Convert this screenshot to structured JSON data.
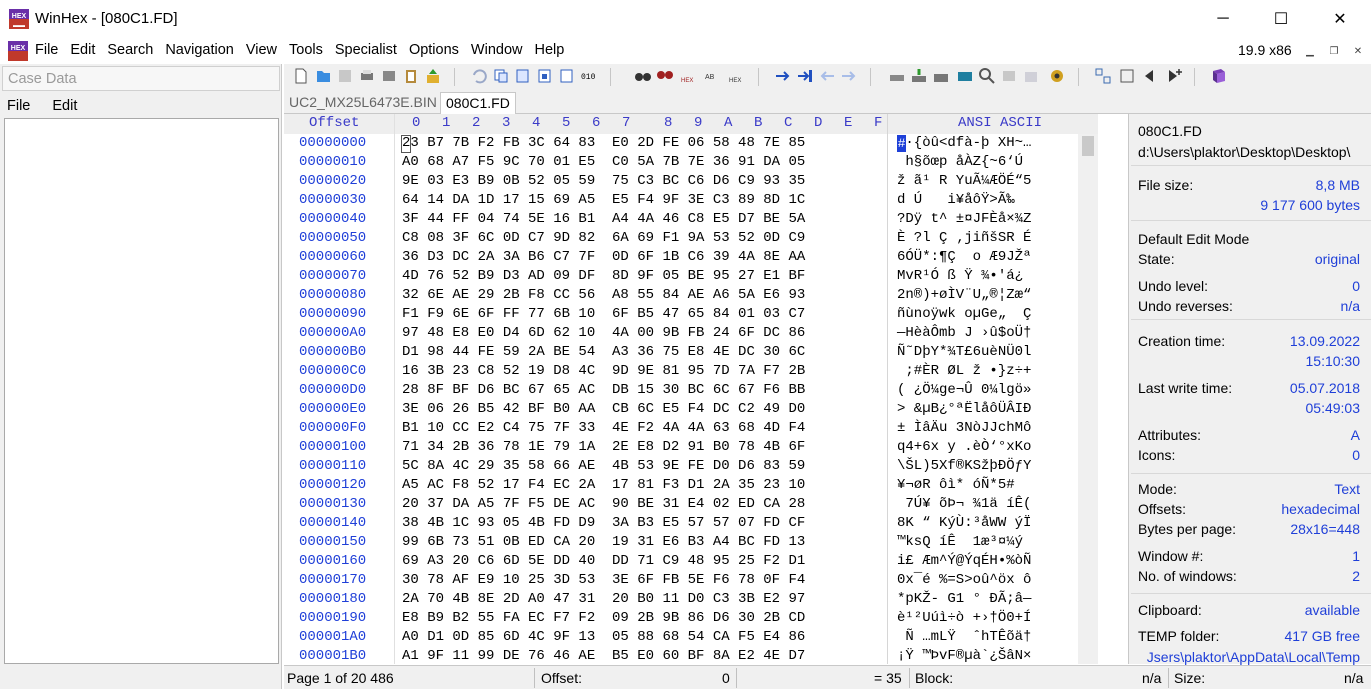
{
  "window": {
    "title": "WinHex - [080C1.FD]",
    "version": "19.9 x86",
    "controls": {
      "minimize": "─",
      "maximize": "☐",
      "close": "✕"
    }
  },
  "menu": [
    "File",
    "Edit",
    "Search",
    "Navigation",
    "View",
    "Tools",
    "Specialist",
    "Options",
    "Window",
    "Help"
  ],
  "case_pane": {
    "header": "Case Data",
    "menu": [
      "File",
      "Edit"
    ]
  },
  "tabs": [
    {
      "label": "UC2_MX25L6473E.BIN",
      "active": false
    },
    {
      "label": "080C1.FD",
      "active": true
    }
  ],
  "hex": {
    "offset_header": "Offset",
    "columns": [
      "0",
      "1",
      "2",
      "3",
      "4",
      "5",
      "6",
      "7",
      "8",
      "9",
      "A",
      "B",
      "C",
      "D",
      "E",
      "F"
    ],
    "ascii_header": "ANSI ASCII",
    "rows": [
      {
        "offset": "00000000",
        "bytes": "23 B7 7B F2 FB 3C 64 83  E0 2D FE 06 58 48 7E 85",
        "ascii": "#·{òû<dfà-þ XH~…"
      },
      {
        "offset": "00000010",
        "bytes": "A0 68 A7 F5 9C 70 01 E5  C0 5A 7B 7E 36 91 DA 05",
        "ascii": " h§õœp åÀZ{~6‘Ú "
      },
      {
        "offset": "00000020",
        "bytes": "9E 03 E3 B9 0B 52 05 59  75 C3 BC C6 D6 C9 93 35",
        "ascii": "ž ã¹ R YuÃ¼ÆÖÉ“5"
      },
      {
        "offset": "00000030",
        "bytes": "64 14 DA 1D 17 15 69 A5  E5 F4 9F 3E C3 89 8D 1C",
        "ascii": "d Ú   i¥åôŸ>Ã‰  "
      },
      {
        "offset": "00000040",
        "bytes": "3F 44 FF 04 74 5E 16 B1  A4 4A 46 C8 E5 D7 BE 5A",
        "ascii": "?Dÿ t^ ±¤JFÈå×¾Z"
      },
      {
        "offset": "00000050",
        "bytes": "C8 08 3F 6C 0D C7 9D 82  6A 69 F1 9A 53 52 0D C9",
        "ascii": "È ?l Ç ‚jiñšSR É"
      },
      {
        "offset": "00000060",
        "bytes": "36 D3 DC 2A 3A B6 C7 7F  0D 6F 1B C6 39 4A 8E AA",
        "ascii": "6ÓÜ*:¶Ç  o Æ9JŽª"
      },
      {
        "offset": "00000070",
        "bytes": "4D 76 52 B9 D3 AD 09 DF  8D 9F 05 BE 95 27 E1 BF",
        "ascii": "MvR¹Ó­ ß Ÿ ¾•'á¿"
      },
      {
        "offset": "00000080",
        "bytes": "32 6E AE 29 2B F8 CC 56  A8 55 84 AE A6 5A E6 93",
        "ascii": "2n®)+øÌV¨U„®¦Zæ“"
      },
      {
        "offset": "00000090",
        "bytes": "F1 F9 6E 6F FF 77 6B 10  6F B5 47 65 84 01 03 C7",
        "ascii": "ñùnoÿwk oµGe„  Ç"
      },
      {
        "offset": "000000A0",
        "bytes": "97 48 E8 E0 D4 6D 62 10  4A 00 9B FB 24 6F DC 86",
        "ascii": "—HèàÔmb J ›û$oÜ†"
      },
      {
        "offset": "000000B0",
        "bytes": "D1 98 44 FE 59 2A BE 54  A3 36 75 E8 4E DC 30 6C",
        "ascii": "Ñ˜DþY*¾T£6uèNÜ0l"
      },
      {
        "offset": "000000C0",
        "bytes": "16 3B 23 C8 52 19 D8 4C  9D 9E 81 95 7D 7A F7 2B",
        "ascii": " ;#ÈR ØL ž •}z÷+"
      },
      {
        "offset": "000000D0",
        "bytes": "28 8F BF D6 BC 67 65 AC  DB 15 30 BC 6C 67 F6 BB",
        "ascii": "( ¿Ö¼ge¬Û 0¼lgö»"
      },
      {
        "offset": "000000E0",
        "bytes": "3E 06 26 B5 42 BF B0 AA  CB 6C E5 F4 DC C2 49 D0",
        "ascii": "> &µB¿°ªËlåôÜÂIÐ"
      },
      {
        "offset": "000000F0",
        "bytes": "B1 10 CC E2 C4 75 7F 33  4E F2 4A 4A 63 68 4D F4",
        "ascii": "± ÌâÄu 3NòJJchMô"
      },
      {
        "offset": "00000100",
        "bytes": "71 34 2B 36 78 1E 79 1A  2E E8 D2 91 B0 78 4B 6F",
        "ascii": "q4+6x y .èÒ‘°xKo"
      },
      {
        "offset": "00000110",
        "bytes": "5C 8A 4C 29 35 58 66 AE  4B 53 9E FE D0 D6 83 59",
        "ascii": "\\ŠL)5Xf®KSžþÐÖƒY"
      },
      {
        "offset": "00000120",
        "bytes": "A5 AC F8 52 17 F4 EC 2A  17 81 F3 D1 2A 35 23 10",
        "ascii": "¥¬øR ôì* óÑ*5# "
      },
      {
        "offset": "00000130",
        "bytes": "20 37 DA A5 7F F5 DE AC  90 BE 31 E4 02 ED CA 28",
        "ascii": " 7Ú¥ õÞ¬ ¾1ä íÊ("
      },
      {
        "offset": "00000140",
        "bytes": "38 4B 1C 93 05 4B FD D9  3A B3 E5 57 57 07 FD CF",
        "ascii": "8K “ KýÙ:³åWW ýÏ"
      },
      {
        "offset": "00000150",
        "bytes": "99 6B 73 51 0B ED CA 20  19 31 E6 B3 A4 BC FD 13",
        "ascii": "™ksQ íÊ  1æ³¤¼ý "
      },
      {
        "offset": "00000160",
        "bytes": "69 A3 20 C6 6D 5E DD 40  DD 71 C9 48 95 25 F2 D1",
        "ascii": "i£ Æm^Ý@ÝqÉH•%òÑ"
      },
      {
        "offset": "00000170",
        "bytes": "30 78 AF E9 10 25 3D 53  3E 6F FB 5E F6 78 0F F4",
        "ascii": "0x¯é %=S>oû^öx ô"
      },
      {
        "offset": "00000180",
        "bytes": "2A 70 4B 8E 2D A0 47 31  20 B0 11 D0 C3 3B E2 97",
        "ascii": "*pKŽ- G1 ° ÐÃ;â—"
      },
      {
        "offset": "00000190",
        "bytes": "E8 B9 B2 55 FA EC F7 F2  09 2B 9B 86 D6 30 2B CD",
        "ascii": "è¹²Uúì÷ò +›†Ö0+Í"
      },
      {
        "offset": "000001A0",
        "bytes": "A0 D1 0D 85 6D 4C 9F 13  05 88 68 54 CA F5 E4 86",
        "ascii": " Ñ …mLŸ  ˆhTÊõä†"
      },
      {
        "offset": "000001B0",
        "bytes": "A1 9F 11 99 DE 76 46 AE  B5 E0 60 BF 8A E2 4E D7",
        "ascii": "¡Ÿ ™ÞvF®µà`¿ŠâN×"
      }
    ]
  },
  "info": {
    "file_name": "080C1.FD",
    "path": "d:\\Users\\plaktor\\Desktop\\Desktop\\",
    "file_size_label": "File size:",
    "file_size_mb": "8,8 MB",
    "file_size_bytes": "9 177 600 bytes",
    "edit_mode_label": "Default Edit Mode",
    "state_label": "State:",
    "state": "original",
    "undo_level_label": "Undo level:",
    "undo_level": "0",
    "undo_reverses_label": "Undo reverses:",
    "undo_reverses": "n/a",
    "creation_label": "Creation time:",
    "creation_date": "13.09.2022",
    "creation_time": "15:10:30",
    "lastwrite_label": "Last write time:",
    "lastwrite_date": "05.07.2018",
    "lastwrite_time": "05:49:03",
    "attributes_label": "Attributes:",
    "attributes": "A",
    "icons_label": "Icons:",
    "icons": "0",
    "mode_label": "Mode:",
    "mode": "Text",
    "offsets_label": "Offsets:",
    "offsets": "hexadecimal",
    "bpp_label": "Bytes per page:",
    "bpp": "28x16=448",
    "window_label": "Window #:",
    "window_no": "1",
    "windows_label": "No. of windows:",
    "windows_count": "2",
    "clipboard_label": "Clipboard:",
    "clipboard": "available",
    "temp_label": "TEMP folder:",
    "temp_free": "417 GB free",
    "temp_path": "Jsers\\plaktor\\AppData\\Local\\Temp"
  },
  "status": {
    "page": "Page 1 of 20 486",
    "offset_label": "Offset:",
    "offset_value": "0",
    "eq_value": "= 35",
    "block_label": "Block:",
    "block_value": "n/a",
    "size_label": "Size:",
    "size_value": "n/a"
  },
  "accent": {
    "offset_blue": "#1f3fd8",
    "cursor_blue": "#1e40d8"
  }
}
